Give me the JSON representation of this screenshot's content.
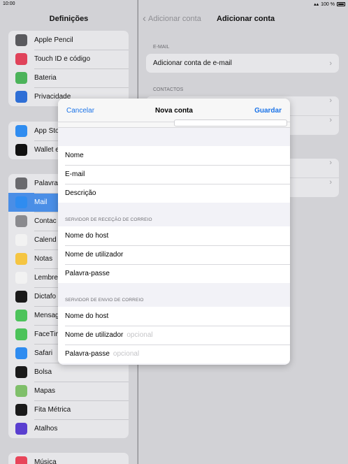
{
  "status_bar": {
    "time": "10:00",
    "battery": "100 %"
  },
  "sidebar": {
    "title": "Definições",
    "group1": [
      {
        "label": "Apple Pencil",
        "icon": "pencil-icon",
        "color": "#5a5a5e"
      },
      {
        "label": "Touch ID e código",
        "icon": "fingerprint-icon",
        "color": "#e0435a"
      },
      {
        "label": "Bateria",
        "icon": "battery-icon",
        "color": "#4cb35a"
      },
      {
        "label": "Privacidade",
        "icon": "hand-icon",
        "color": "#2f6fd6"
      }
    ],
    "group2": [
      {
        "label": "App Sto",
        "icon": "app-store-icon",
        "color": "#2f8cf0"
      },
      {
        "label": "Wallet e",
        "icon": "wallet-icon",
        "color": "#111111"
      }
    ],
    "group3": [
      {
        "label": "Palavra",
        "icon": "key-icon",
        "color": "#6a6a6e"
      },
      {
        "label": "Mail",
        "icon": "mail-icon",
        "color": "#2f8cf0",
        "active": true
      },
      {
        "label": "Contac",
        "icon": "contacts-icon",
        "color": "#8a8a8e"
      },
      {
        "label": "Calend",
        "icon": "calendar-icon",
        "color": "#f2f2f2"
      },
      {
        "label": "Notas",
        "icon": "notes-icon",
        "color": "#f5c542"
      },
      {
        "label": "Lembre",
        "icon": "reminders-icon",
        "color": "#f2f2f2"
      },
      {
        "label": "Dictafo",
        "icon": "voice-memos-icon",
        "color": "#1a1a1a"
      },
      {
        "label": "Mensag",
        "icon": "messages-icon",
        "color": "#4cc35a"
      },
      {
        "label": "FaceTim",
        "icon": "facetime-icon",
        "color": "#4cc35a"
      },
      {
        "label": "Safari",
        "icon": "safari-icon",
        "color": "#2f8cf0"
      },
      {
        "label": "Bolsa",
        "icon": "stocks-icon",
        "color": "#1a1a1a"
      },
      {
        "label": "Mapas",
        "icon": "maps-icon",
        "color": "#7fbf6a"
      },
      {
        "label": "Fita Métrica",
        "icon": "measure-icon",
        "color": "#1a1a1a"
      },
      {
        "label": "Atalhos",
        "icon": "shortcuts-icon",
        "color": "#5a3fd0"
      }
    ],
    "group4": [
      {
        "label": "Música",
        "icon": "music-icon",
        "color": "#e8455a"
      }
    ]
  },
  "main": {
    "back_label": "Adicionar conta",
    "title": "Adicionar conta",
    "email_section": "E-MAIL",
    "add_email": "Adicionar conta de e-mail",
    "contacts_section": "CONTACTOS"
  },
  "modal": {
    "cancel": "Cancelar",
    "title": "Nova conta",
    "save": "Guardar",
    "fields": [
      {
        "label": "Nome"
      },
      {
        "label": "E-mail"
      },
      {
        "label": "Descrição"
      }
    ],
    "incoming_section": "SERVIDOR DE RECEÇÃO DE CORREIO",
    "incoming": [
      {
        "label": "Nome do host",
        "placeholder": ""
      },
      {
        "label": "Nome de utilizador",
        "placeholder": ""
      },
      {
        "label": "Palavra-passe",
        "placeholder": ""
      }
    ],
    "outgoing_section": "SERVIDOR DE ENVIO DE CORREIO",
    "outgoing": [
      {
        "label": "Nome do host",
        "placeholder": ""
      },
      {
        "label": "Nome de utilizador",
        "placeholder": "opcional"
      },
      {
        "label": "Palavra-passe",
        "placeholder": "opcional"
      }
    ]
  }
}
